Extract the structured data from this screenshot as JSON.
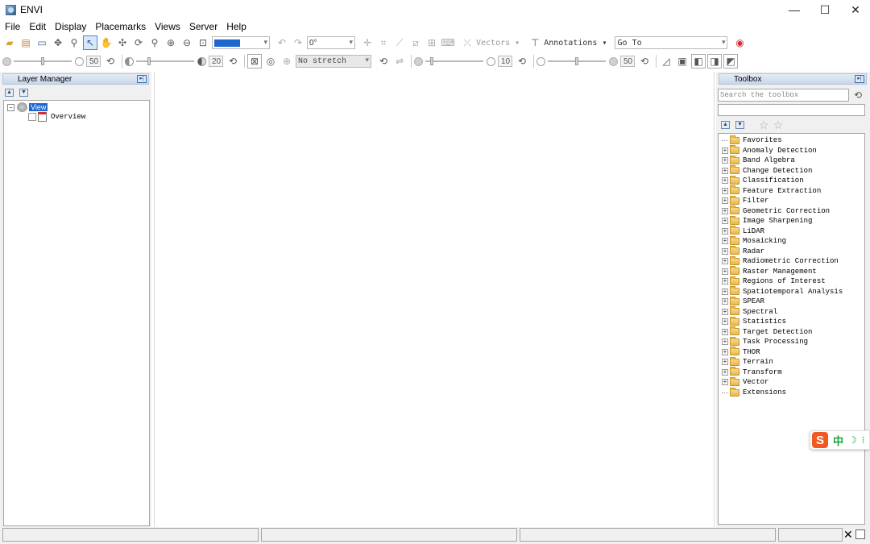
{
  "window": {
    "title": "ENVI",
    "minimize_glyph": "—",
    "maximize_glyph": "☐",
    "close_glyph": "✕"
  },
  "menu": [
    "File",
    "Edit",
    "Display",
    "Placemarks",
    "Views",
    "Server",
    "Help"
  ],
  "toolbar1": {
    "rotation_value": "0°",
    "vectors_label": "Vectors",
    "annotations_label": "Annotations",
    "goto_value": "Go To"
  },
  "toolbar2": {
    "brightness_value": "50",
    "contrast_value": "20",
    "stretch_value": "No stretch",
    "sharpen_value": "10",
    "transparency_value": "50"
  },
  "layer_manager": {
    "title": "Layer Manager",
    "root": "View",
    "child": "Overview"
  },
  "toolbox": {
    "title": "Toolbox",
    "search_placeholder": "Search the toolbox",
    "favorites": "Favorites",
    "items": [
      "Anomaly Detection",
      "Band Algebra",
      "Change Detection",
      "Classification",
      "Feature Extraction",
      "Filter",
      "Geometric Correction",
      "Image Sharpening",
      "LiDAR",
      "Mosaicking",
      "Radar",
      "Radiometric Correction",
      "Raster Management",
      "Regions of Interest",
      "Spatiotemporal Analysis",
      "SPEAR",
      "Spectral",
      "Statistics",
      "Target Detection",
      "Task Processing",
      "THOR",
      "Terrain",
      "Transform",
      "Vector"
    ],
    "extensions": "Extensions"
  },
  "ime": {
    "logo": "S",
    "lang": "中",
    "moon": "☽",
    "dots": "⁝"
  },
  "colors": {
    "accent": "#1e66d0",
    "panel_bg": "#f0f0f0",
    "folder": "#e8b84a",
    "ime_orange": "#f05a22",
    "ime_green": "#1aa23a"
  }
}
